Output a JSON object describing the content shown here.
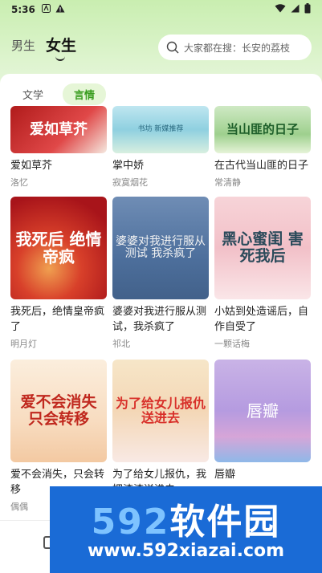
{
  "status": {
    "time": "5:36"
  },
  "gender_tabs": {
    "male": "男生",
    "female": "女生"
  },
  "search": {
    "placeholder": "大家都在搜：长安的荔枝"
  },
  "sub_tabs": {
    "literature": "文学",
    "romance": "言情"
  },
  "books": [
    {
      "title": "爱如草芥",
      "author": "洛忆",
      "cover_text": "爱如草芥"
    },
    {
      "title": "掌中娇",
      "author": "寂寞烟花",
      "cover_text": "书坊 新媒推荐"
    },
    {
      "title": "在古代当山匪的日子",
      "author": "常清静",
      "cover_text": "当山匪的日子"
    },
    {
      "title": "我死后，绝情皇帝疯了",
      "author": "明月灯",
      "cover_text": "我死后 绝情帝疯"
    },
    {
      "title": "婆婆对我进行服从测试，我杀疯了",
      "author": "祁北",
      "cover_text": "婆婆对我进行服从测试 我杀疯了"
    },
    {
      "title": "小姑到处造谣后，自作自受了",
      "author": "一颗话梅",
      "cover_text": "黑心蜜闺 害死我后"
    },
    {
      "title": "爱不会消失，只会转移",
      "author": "偶偶",
      "cover_text": "爱不会消失 只会转移"
    },
    {
      "title": "为了给女儿报仇，我把渣渣送进去",
      "author": "",
      "cover_text": "为了给女儿报仇 送进去"
    },
    {
      "title": "唇瓣",
      "author": "",
      "cover_text": "唇瓣"
    }
  ],
  "watermark": {
    "brand_num": "592",
    "brand_text": "软件园",
    "url": "www.592xiazai.com"
  }
}
